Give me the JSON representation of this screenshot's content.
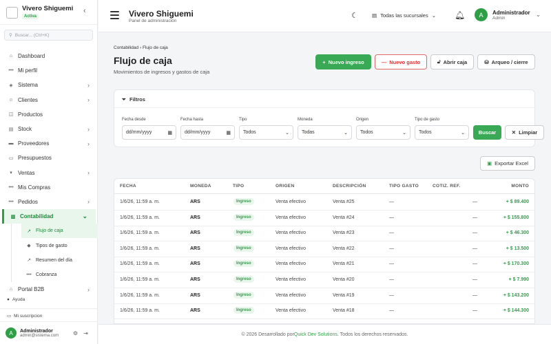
{
  "brand": {
    "name": "Vivero Shiguemi",
    "status": "Activa"
  },
  "search": {
    "placeholder": "Buscar... (Ctrl+K)"
  },
  "sidebar": {
    "items": [
      {
        "label": "Dashboard",
        "icon": "grid-icon",
        "chev": false
      },
      {
        "label": "Mi perfil",
        "icon": "dots-icon",
        "chev": false
      },
      {
        "label": "Sistema",
        "icon": "shield-icon",
        "chev": true
      },
      {
        "label": "Clientes",
        "icon": "users-icon",
        "chev": true
      },
      {
        "label": "Productos",
        "icon": "box-icon",
        "chev": false
      },
      {
        "label": "Stock",
        "icon": "stack-icon",
        "chev": true
      },
      {
        "label": "Proveedores",
        "icon": "truck-icon",
        "chev": true
      },
      {
        "label": "Presupuestos",
        "icon": "doc-icon",
        "chev": false
      },
      {
        "label": "Ventas",
        "icon": "cart-icon",
        "chev": true
      },
      {
        "label": "Mis Compras",
        "icon": "dots-icon",
        "chev": false
      },
      {
        "label": "Pedidos",
        "icon": "dots-icon",
        "chev": true
      },
      {
        "label": "Contabilidad",
        "icon": "ledger-icon",
        "chev": true
      }
    ],
    "sub": [
      "Flujo de caja",
      "Tipos de gasto",
      "Resumen del día",
      "Cobranza"
    ],
    "after": {
      "label": "Portal B2B"
    },
    "help": "Ayuda",
    "subscription": "Mi suscripcion",
    "user": {
      "name": "Administrador",
      "email": "admin@sistema.com",
      "initial": "A"
    }
  },
  "header": {
    "title": "Vivero Shiguemi",
    "subtitle": "Panel de administración",
    "branch": "Todas las sucursales",
    "user": {
      "name": "Administrador",
      "role": "Admin",
      "initial": "A"
    }
  },
  "breadcrumb": {
    "parent": "Contabilidad",
    "current": "Flujo de caja"
  },
  "page": {
    "title": "Flujo de caja",
    "subtitle": "Movimientos de ingresos y gastos de caja"
  },
  "actions": {
    "new_income": "Nuevo ingreso",
    "new_expense": "Nuevo gasto",
    "open_cash": "Abrir caja",
    "close_cash": "Arqueo / cierre"
  },
  "filters": {
    "title": "Filtros",
    "date_from": {
      "label": "Fecha desde",
      "value": "dd/mm/yyyy"
    },
    "date_to": {
      "label": "Fecha hasta",
      "value": "dd/mm/yyyy"
    },
    "type": {
      "label": "Tipo",
      "value": "Todos"
    },
    "currency": {
      "label": "Moneda",
      "value": "Todas"
    },
    "origin": {
      "label": "Origen",
      "value": "Todos"
    },
    "expense_type": {
      "label": "Tipo de gasto",
      "value": "Todos"
    },
    "search_button": "Buscar",
    "clear_button": "Limpiar"
  },
  "export": "Exportar Excel",
  "table": {
    "headers": [
      "FECHA",
      "MONEDA",
      "TIPO",
      "ORIGEN",
      "DESCRIPCIÓN",
      "TIPO GASTO",
      "COTIZ. REF.",
      "MONTO"
    ],
    "rows": [
      [
        "1/6/26, 11:59 a. m.",
        "ARS",
        "Ingreso",
        "Venta efectivo",
        "Venta #25",
        "—",
        "—",
        "+ $ 89.400"
      ],
      [
        "1/6/26, 11:59 a. m.",
        "ARS",
        "Ingreso",
        "Venta efectivo",
        "Venta #24",
        "—",
        "—",
        "+ $ 155.800"
      ],
      [
        "1/6/26, 11:59 a. m.",
        "ARS",
        "Ingreso",
        "Venta efectivo",
        "Venta #23",
        "—",
        "—",
        "+ $ 46.300"
      ],
      [
        "1/6/26, 11:59 a. m.",
        "ARS",
        "Ingreso",
        "Venta efectivo",
        "Venta #22",
        "—",
        "—",
        "+ $ 13.500"
      ],
      [
        "1/6/26, 11:59 a. m.",
        "ARS",
        "Ingreso",
        "Venta efectivo",
        "Venta #21",
        "—",
        "—",
        "+ $ 170.300"
      ],
      [
        "1/6/26, 11:59 a. m.",
        "ARS",
        "Ingreso",
        "Venta efectivo",
        "Venta #20",
        "—",
        "—",
        "+ $ 7.990"
      ],
      [
        "1/6/26, 11:59 a. m.",
        "ARS",
        "Ingreso",
        "Venta efectivo",
        "Venta #19",
        "—",
        "—",
        "+ $ 143.200"
      ],
      [
        "1/6/26, 11:59 a. m.",
        "ARS",
        "Ingreso",
        "Venta efectivo",
        "Venta #18",
        "—",
        "—",
        "+ $ 144.300"
      ]
    ]
  },
  "footer": {
    "before": "© 2026 Desarrollado por ",
    "link": "Quick Dev Solutions",
    "after": ". Todos los derechos reservados."
  }
}
